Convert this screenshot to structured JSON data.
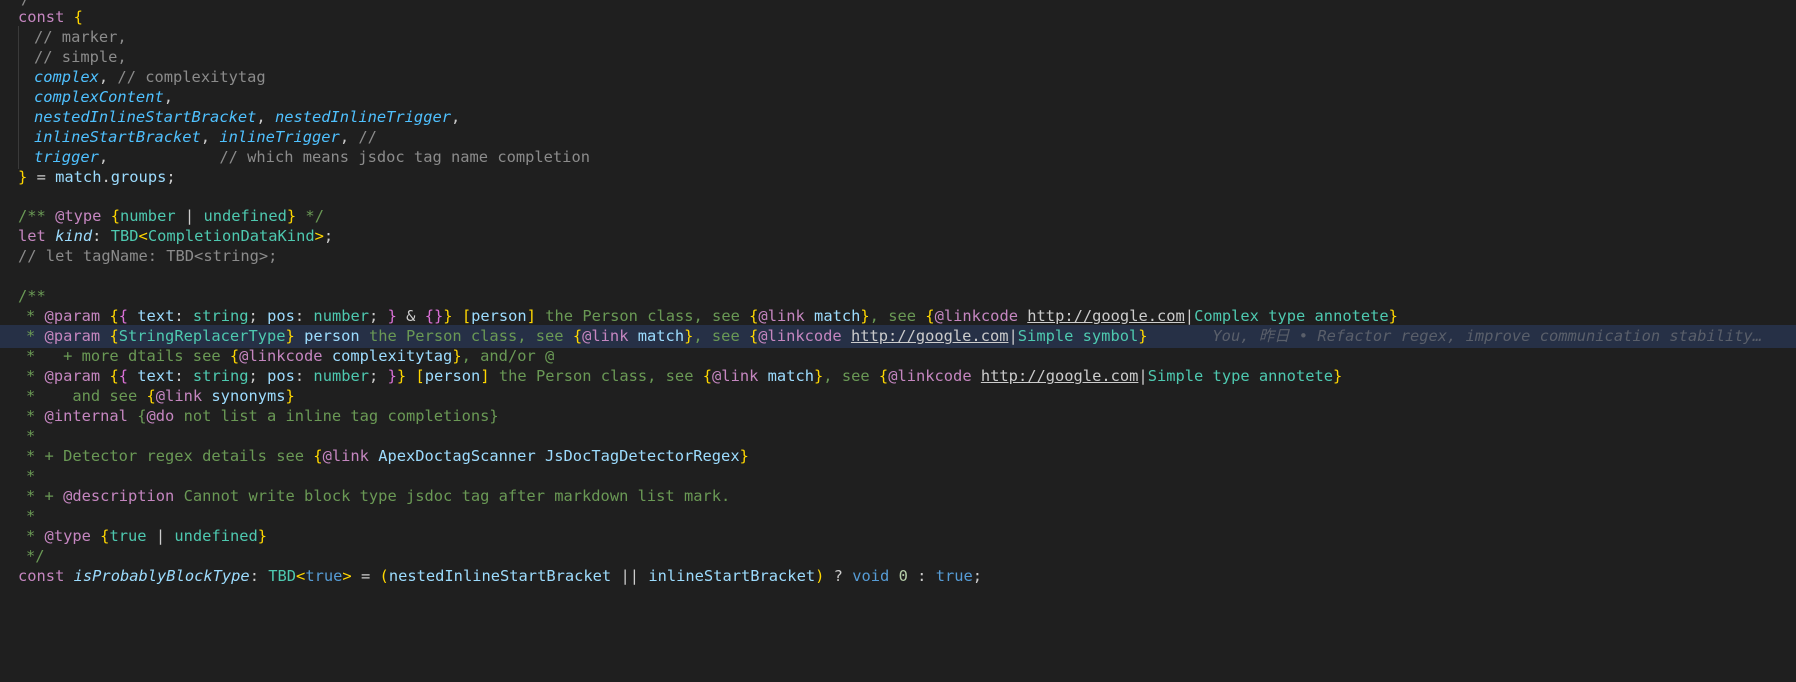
{
  "editor": {
    "blame_text": "You, 昨日 • Refactor regex, improve communication stability…",
    "lines": [
      {
        "text": "  /",
        "y": -7
      },
      {
        "text": "const {",
        "y": 0
      },
      {
        "text": "  // marker,",
        "y": 0
      },
      {
        "text": "  // simple,",
        "y": 0
      },
      {
        "text": "  complex, // complexitytag",
        "y": 0
      },
      {
        "text": "  complexContent,",
        "y": 0
      },
      {
        "text": "  nestedInlineStartBracket, nestedInlineTrigger,",
        "y": 0
      },
      {
        "text": "  inlineStartBracket, inlineTrigger, //",
        "y": 0
      },
      {
        "text": "  trigger,            // which means jsdoc tag name completion",
        "y": 0
      },
      {
        "text": "} = match.groups;",
        "y": 0
      }
    ]
  },
  "code": {
    "l0": "/",
    "l1_kw": "const",
    "l1_br": "{",
    "l2": "// marker,",
    "l3": "// simple,",
    "l4_v": "complex",
    "l4_c": "// complexitytag",
    "l5_v": "complexContent",
    "l6_v1": "nestedInlineStartBracket",
    "l6_v2": "nestedInlineTrigger",
    "l7_v1": "inlineStartBracket",
    "l7_v2": "inlineTrigger",
    "l7_c": "//",
    "l8_v": "trigger",
    "l8_c": "// which means jsdoc tag name completion",
    "l9_br": "}",
    "l9_eq": "=",
    "l9_m": "match",
    "l9_g": "groups",
    "l11_open": "/**",
    "l11_tag": "@type",
    "l11_t1": "number",
    "l11_bar": "|",
    "l11_t2": "undefined",
    "l11_close": "*/",
    "l12_kw": "let",
    "l12_v": "kind",
    "l12_t": "TBD",
    "l12_gt": "CompletionDataKind",
    "l13": "// let tagName: TBD<string>;",
    "l15": "/**",
    "l16_star": "*",
    "l16_tag": "@param",
    "l16_t1": "text",
    "l16_t2": "string",
    "l16_t3": "pos",
    "l16_t4": "number",
    "l16_person": "person",
    "l16_desc": "the Person class, see",
    "l16_link": "@link",
    "l16_match": "match",
    "l16_see": ", see",
    "l16_linkcode": "@linkcode",
    "l16_url": "http://google.com",
    "l16_label": "Complex type annotete",
    "l17_tag": "@param",
    "l17_type": "StringReplacerType",
    "l17_person": "person",
    "l17_desc": "the Person class, see",
    "l17_link": "@link",
    "l17_match": "match",
    "l17_see": ", see",
    "l17_linkcode": "@linkcode",
    "l17_url": "http://google.com",
    "l17_label": "Simple symbol",
    "l18_pre": "+ more dtails see",
    "l18_linkcode": "@linkcode",
    "l18_target": "complexitytag",
    "l18_post": ", and/or @",
    "l19_tag": "@param",
    "l19_t1": "text",
    "l19_t2": "string",
    "l19_t3": "pos",
    "l19_t4": "number",
    "l19_person": "person",
    "l19_desc": "the Person class, see",
    "l19_link": "@link",
    "l19_match": "match",
    "l19_see": ", see",
    "l19_linkcode": "@linkcode",
    "l19_url": "http://google.com",
    "l19_label": "Simple type annotete",
    "l20_pre": "and see",
    "l20_link": "@link",
    "l20_target": "synonyms",
    "l21_tag": "@internal",
    "l21_do": "@do",
    "l21_rest": "not list a inline tag completions}",
    "l22": "*",
    "l23_pre": "+ Detector regex details see",
    "l23_link": "@link",
    "l23_a": "ApexDoctagScanner",
    "l23_b": "JsDocTagDetectorRegex",
    "l24": "*",
    "l25_pre": "+",
    "l25_tag": "@description",
    "l25_rest": "Cannot write block type jsdoc tag after markdown list mark.",
    "l26": "*",
    "l27_tag": "@type",
    "l27_t1": "true",
    "l27_bar": "|",
    "l27_t2": "undefined",
    "l28": "*/",
    "l29_kw": "const",
    "l29_v": "isProbablyBlockType",
    "l29_t": "TBD",
    "l29_gt": "true",
    "l29_a": "nestedInlineStartBracket",
    "l29_or": "||",
    "l29_b": "inlineStartBracket",
    "l29_q": "?",
    "l29_void": "void",
    "l29_zero": "0",
    "l29_colon": ":",
    "l29_true": "true"
  }
}
